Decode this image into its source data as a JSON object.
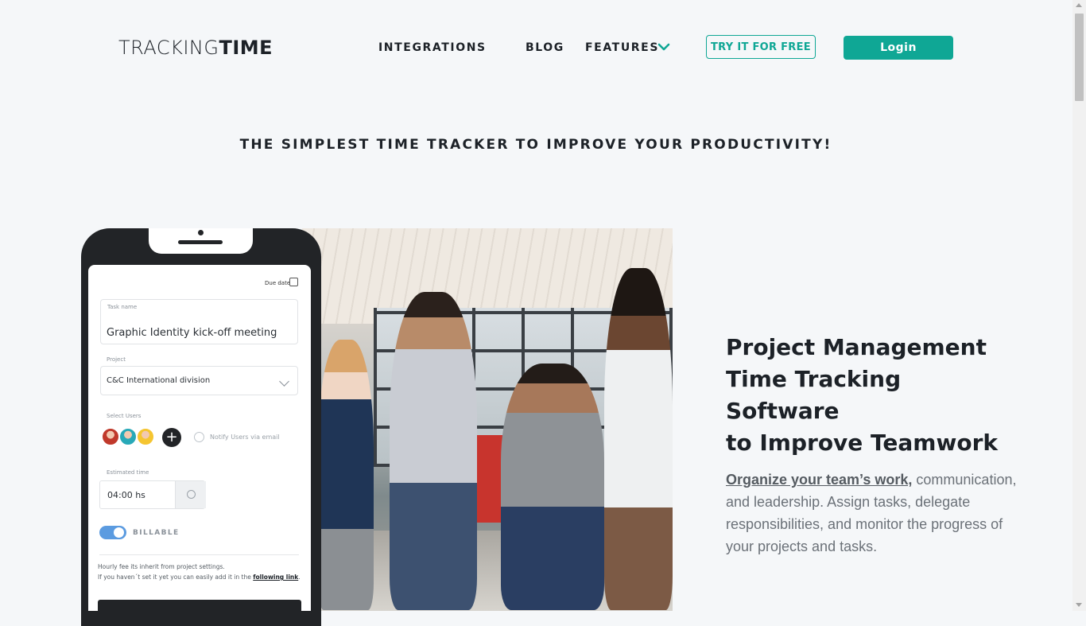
{
  "header": {
    "logo_light": "TRACKING",
    "logo_bold": "TIME",
    "nav": {
      "integrations": "INTEGRATIONS",
      "blog": "BLOG",
      "features": "FEATURES"
    },
    "try_button": "TRY IT FOR FREE",
    "login_button": "Login"
  },
  "tagline": "THE SIMPLEST TIME TRACKER TO IMPROVE YOUR PRODUCTIVITY!",
  "phone_app": {
    "due_date": "Due date",
    "task_name_label": "Task name",
    "task_name_value": "Graphic Identity kick-off meeting",
    "project_label": "Project",
    "project_value": "C&C International division",
    "select_users_label": "Select Users",
    "notify_label": "Notify Users via email",
    "estimated_time_label": "Estimated time",
    "estimated_time_value": "04:00 hs",
    "billable_label": "BILLABLE",
    "billable_on": true,
    "note_line1": "Hourly fee its inherit from project settings.",
    "note_line2": "If you haven´t set it yet you can easily add it in the",
    "note_link": "following link",
    "note_end": "."
  },
  "hero": {
    "headline_lines": [
      "Project Management",
      "Time Tracking Software",
      "to Improve Teamwork"
    ],
    "desc_link": "Organize your team’s work,",
    "desc_text": " communication, and leadership. Assign tasks, delegate responsibilities, and monitor the progress of your projects and tasks."
  },
  "colors": {
    "accent": "#0fa795",
    "background": "#f5f7f9",
    "text_dark": "#1c2127",
    "text_muted": "#6b7178"
  },
  "icons": {
    "features_chevron": "chevron-down-icon",
    "due_date": "calendar-icon",
    "project_dropdown": "chevron-down-icon",
    "add_user": "plus-icon",
    "notify": "check-circle-icon",
    "timer": "stopwatch-icon"
  }
}
